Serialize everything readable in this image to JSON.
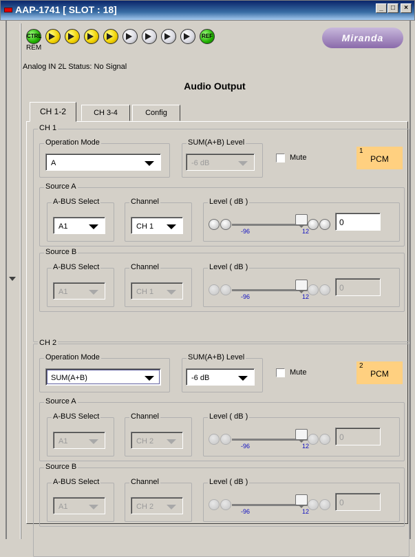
{
  "window": {
    "title": "AAP-1741 [ SLOT : 18]",
    "min": "_",
    "max": "□",
    "close": "×"
  },
  "leds": [
    {
      "label": "CTRL",
      "kind": "g"
    },
    {
      "label": "",
      "kind": "y"
    },
    {
      "label": "",
      "kind": "y"
    },
    {
      "label": "",
      "kind": "y"
    },
    {
      "label": "",
      "kind": "y"
    },
    {
      "label": "",
      "kind": "gr"
    },
    {
      "label": "",
      "kind": "gr"
    },
    {
      "label": "",
      "kind": "gr"
    },
    {
      "label": "",
      "kind": "gr"
    },
    {
      "label": "REF",
      "kind": "g"
    }
  ],
  "rem": "REM",
  "brand": "Miranda",
  "status": "Analog IN 2L Status: No Signal",
  "panel_title": "Audio Output",
  "tabs": [
    "CH 1-2",
    "CH 3-4",
    "Config"
  ],
  "labels": {
    "op": "Operation Mode",
    "sum": "SUM(A+B) Level",
    "mute": "Mute",
    "srcA": "Source A",
    "srcB": "Source B",
    "bus": "A-BUS Select",
    "chan": "Channel",
    "level": "Level ( dB )",
    "min": "-96",
    "max": "12"
  },
  "ch1": {
    "title": "CH 1",
    "mode": "A",
    "sum": "-6 dB",
    "pcm_num": "1",
    "pcm": "PCM",
    "a": {
      "bus": "A1",
      "chan": "CH 1",
      "level": "0"
    },
    "b": {
      "bus": "A1",
      "chan": "CH 1",
      "level": "0"
    }
  },
  "ch2": {
    "title": "CH 2",
    "mode": "SUM(A+B)",
    "sum": "-6 dB",
    "pcm_num": "2",
    "pcm": "PCM",
    "a": {
      "bus": "A1",
      "chan": "CH 2",
      "level": "0"
    },
    "b": {
      "bus": "A1",
      "chan": "CH 2",
      "level": "0"
    }
  }
}
